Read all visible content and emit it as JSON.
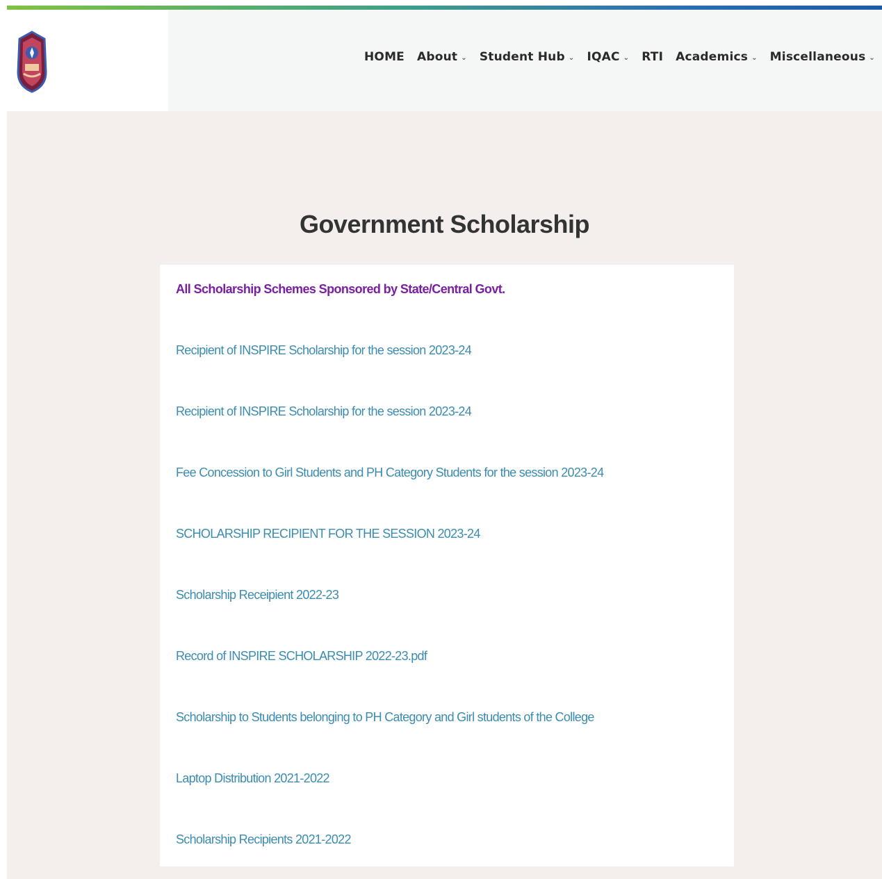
{
  "header": {
    "logo": {
      "icon": "college-crest-icon"
    },
    "nav": [
      {
        "label": "HOME",
        "has_dropdown": false
      },
      {
        "label": "About",
        "has_dropdown": true
      },
      {
        "label": "Student Hub",
        "has_dropdown": true
      },
      {
        "label": "IQAC",
        "has_dropdown": true
      },
      {
        "label": "RTI",
        "has_dropdown": false
      },
      {
        "label": "Academics",
        "has_dropdown": true
      },
      {
        "label": "Miscellaneous",
        "has_dropdown": true
      }
    ],
    "dropdown_icon": "chevron-down-icon"
  },
  "main": {
    "title": "Government Scholarship",
    "links": [
      {
        "label": "All Scholarship Schemes Sponsored by State/Central Govt.",
        "style": "primary"
      },
      {
        "label": "Recipient of INSPIRE Scholarship for the session 2023-24"
      },
      {
        "label": "Recipient of INSPIRE Scholarship for the session 2023-24"
      },
      {
        "label": "Fee Concession to Girl Students and PH Category Students for the session 2023-24"
      },
      {
        "label": "SCHOLARSHIP RECIPIENT FOR THE SESSION 2023-24"
      },
      {
        "label": "Scholarship Receipient 2022-23"
      },
      {
        "label": "Record of INSPIRE SCHOLARSHIP 2022-23.pdf"
      },
      {
        "label": "Scholarship to Students belonging to PH Category and Girl students of the College"
      },
      {
        "label": "Laptop Distribution 2021-2022"
      },
      {
        "label": "Scholarship Recipients 2021-2022"
      }
    ]
  },
  "colors": {
    "page_background": "#f4efec",
    "header_background": "#f5f6f6",
    "primary_link": "#7a1fa2",
    "link": "#3b8cb0",
    "stripe_start": "#7fc241",
    "stripe_end": "#1f5aa6"
  }
}
